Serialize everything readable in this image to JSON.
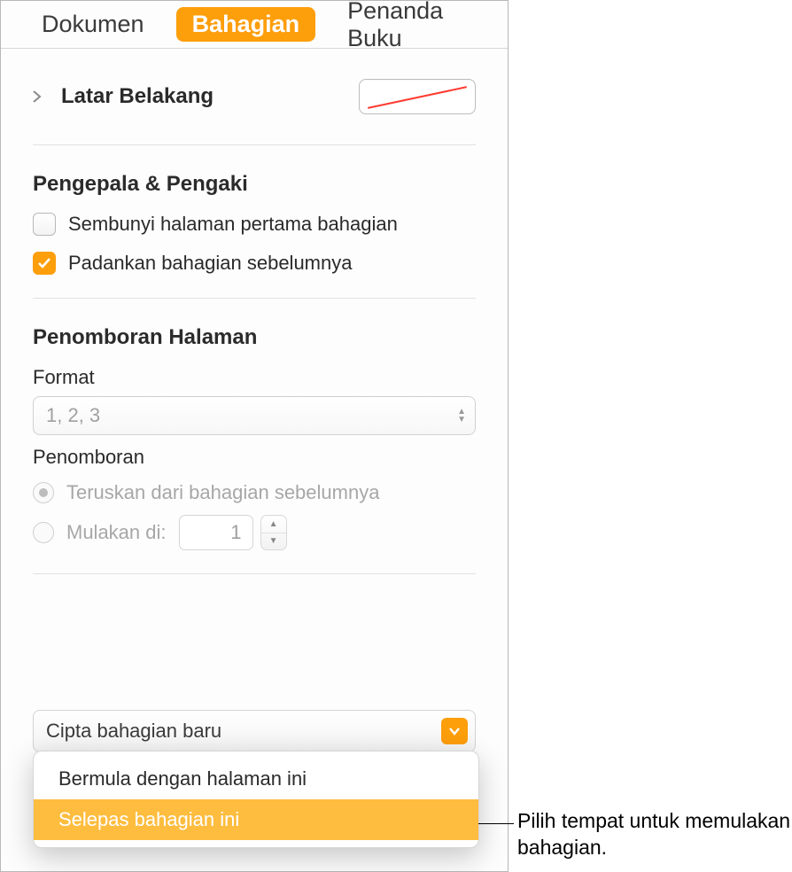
{
  "tabs": {
    "dokumen": "Dokumen",
    "bahagian": "Bahagian",
    "penanda_buku": "Penanda Buku"
  },
  "background": {
    "label": "Latar Belakang"
  },
  "header_footer": {
    "heading": "Pengepala & Pengaki",
    "hide_first": "Sembunyi halaman pertama bahagian",
    "match_prev": "Padankan bahagian sebelumnya"
  },
  "page_numbering": {
    "heading": "Penomboran Halaman",
    "format_label": "Format",
    "format_value": "1, 2, 3",
    "numbering_label": "Penomboran",
    "continue_label": "Teruskan dari bahagian sebelumnya",
    "start_at_label": "Mulakan di:",
    "start_at_value": "1"
  },
  "create_section": {
    "button_label": "Cipta bahagian baru",
    "option_start_here": "Bermula dengan halaman ini",
    "option_after_this": "Selepas bahagian ini"
  },
  "callout": "Pilih tempat untuk memulakan bahagian."
}
